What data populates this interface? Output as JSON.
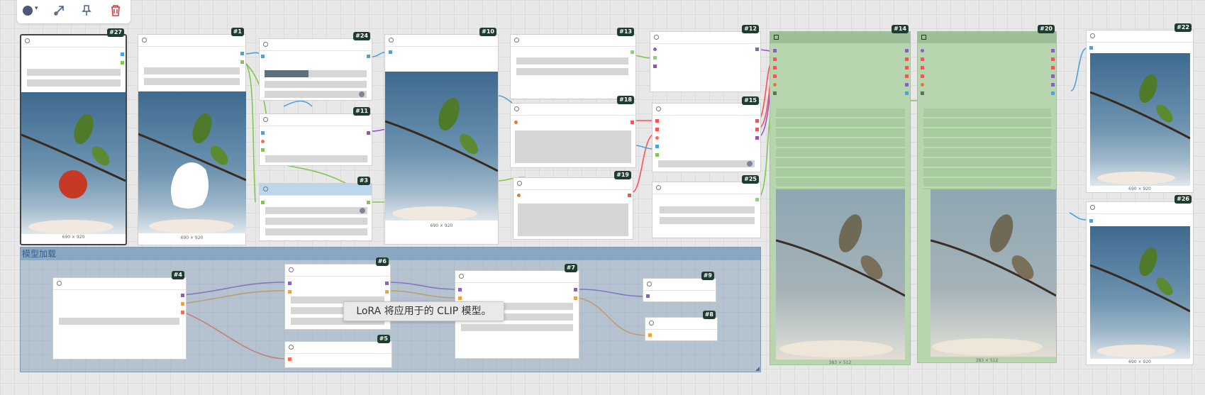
{
  "toolbar": {
    "color_icon": "color-circle-icon",
    "color_value": "#4a5a78",
    "icons": [
      "chevron-down-icon",
      "bypass-icon",
      "pin-icon",
      "trash-icon"
    ]
  },
  "group": {
    "title": "模型加载"
  },
  "tooltip": {
    "text": "LoRA 将应用于的 CLIP 模型。"
  },
  "nodes": {
    "n27": {
      "id": "#27",
      "dim": "690 × 920"
    },
    "n1": {
      "id": "#1",
      "dim": "690 × 920"
    },
    "n24": {
      "id": "#24"
    },
    "n11": {
      "id": "#11"
    },
    "n3": {
      "id": "#3"
    },
    "n10": {
      "id": "#10",
      "dim": "690 × 920"
    },
    "n13": {
      "id": "#13"
    },
    "n18": {
      "id": "#18"
    },
    "n19": {
      "id": "#19"
    },
    "n12": {
      "id": "#12"
    },
    "n15": {
      "id": "#15"
    },
    "n25": {
      "id": "#25"
    },
    "n14": {
      "id": "#14",
      "dim": "383 × 512"
    },
    "n20": {
      "id": "#20",
      "dim": "383 × 512"
    },
    "n22": {
      "id": "#22",
      "dim": "690 × 920"
    },
    "n26": {
      "id": "#26",
      "dim": "690 × 920"
    },
    "n4": {
      "id": "#4"
    },
    "n6": {
      "id": "#6"
    },
    "n5": {
      "id": "#5"
    },
    "n7": {
      "id": "#7"
    },
    "n9": {
      "id": "#9"
    },
    "n8": {
      "id": "#8"
    }
  },
  "colors": {
    "model": "#8d5ccf",
    "clip": "#f2a23c",
    "vae": "#ff6b4a",
    "image": "#4aa3df",
    "mask": "#7ec850",
    "latent": "#e24a8d",
    "conditioning": "#f2c94c",
    "control": "#5fa55a"
  }
}
